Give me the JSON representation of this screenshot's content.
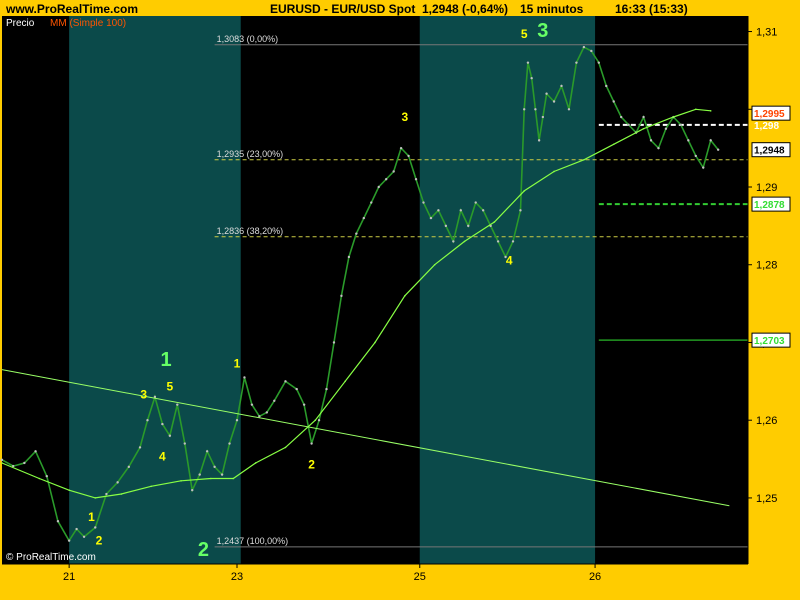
{
  "header": {
    "site": "www.ProRealTime.com",
    "instrument": "EURUSD - EUR/USD Spot",
    "last_quote": "1,2948 (-0,64%)",
    "interval": "15 minutos",
    "clock": "16:33 (15:33)"
  },
  "legend": {
    "price_label": "Precio",
    "ma_label": "MM (Simple 100)"
  },
  "copyright": "© ProRealTime.com",
  "colors": {
    "background": "#ffcc00",
    "plot_bg": "#000000",
    "band_bg": "#0b4a4a",
    "candles": "#2a9a2a",
    "ma_line": "#88ff44",
    "trendline": "#99ff66",
    "fib_line": "#cccc44",
    "wave_labels": "#ffff00",
    "wave_labels_major": "#66ff66"
  },
  "chart_data": {
    "type": "line",
    "title": "",
    "y_axis": {
      "range": [
        1.2415,
        1.312
      ],
      "ticks": [
        {
          "v": 1.31,
          "label": "1,31"
        },
        {
          "v": 1.3,
          "label": "1,30"
        },
        {
          "v": 1.29,
          "label": "1,29"
        },
        {
          "v": 1.28,
          "label": "1,28"
        },
        {
          "v": 1.27,
          "label": "1,27"
        },
        {
          "v": 1.26,
          "label": "1,26"
        },
        {
          "v": 1.25,
          "label": "1,25"
        }
      ]
    },
    "x_axis": {
      "range": [
        0,
        200
      ],
      "ticks": [
        {
          "t": 18,
          "label": "21"
        },
        {
          "t": 63,
          "label": "23"
        },
        {
          "t": 112,
          "label": "25"
        },
        {
          "t": 159,
          "label": "26"
        }
      ]
    },
    "shaded_periods": [
      [
        18,
        64
      ],
      [
        112,
        159
      ]
    ],
    "fibonacci_levels": [
      {
        "price": 1.3083,
        "label": "1,3083 (0,00%)",
        "from_t": 57
      },
      {
        "price": 1.2935,
        "label": "1,2935 (23,00%)",
        "from_t": 57
      },
      {
        "price": 1.2836,
        "label": "1,2836 (38,20%)",
        "from_t": 57
      },
      {
        "price": 1.2437,
        "label": "1,2437 (100,00%)",
        "from_t": 57
      }
    ],
    "price_markers": [
      {
        "price": 1.2995,
        "label": "1,2995",
        "color": "#ff4400",
        "boxed": true,
        "line": false
      },
      {
        "price": 1.298,
        "label": "1,298",
        "color": "#ffffff",
        "boxed": false,
        "line": true,
        "dash": true,
        "line_color": "#ffffff",
        "from_t": 160
      },
      {
        "price": 1.2948,
        "label": "1,2948",
        "color": "#000000",
        "boxed": true,
        "line": false
      },
      {
        "price": 1.2878,
        "label": "1,2878",
        "color": "#33dd33",
        "boxed": true,
        "line": true,
        "dash": true,
        "line_color": "#33cc33",
        "from_t": 160
      },
      {
        "price": 1.2703,
        "label": "1,2703",
        "color": "#33dd33",
        "boxed": true,
        "line": true,
        "dash": false,
        "line_color": "#229922",
        "from_t": 160
      }
    ],
    "series": [
      {
        "name": "Precio",
        "points": [
          [
            0,
            1.2549
          ],
          [
            3,
            1.2541
          ],
          [
            6,
            1.2545
          ],
          [
            9,
            1.256
          ],
          [
            12,
            1.2528
          ],
          [
            15,
            1.247
          ],
          [
            18,
            1.2445
          ],
          [
            20,
            1.246
          ],
          [
            22,
            1.245
          ],
          [
            25,
            1.2462
          ],
          [
            28,
            1.2505
          ],
          [
            31,
            1.252
          ],
          [
            34,
            1.254
          ],
          [
            37,
            1.2565
          ],
          [
            39,
            1.26
          ],
          [
            41,
            1.263
          ],
          [
            43,
            1.2595
          ],
          [
            45,
            1.258
          ],
          [
            47,
            1.262
          ],
          [
            49,
            1.257
          ],
          [
            51,
            1.251
          ],
          [
            53,
            1.253
          ],
          [
            55,
            1.256
          ],
          [
            57,
            1.254
          ],
          [
            59,
            1.253
          ],
          [
            61,
            1.257
          ],
          [
            63,
            1.26
          ],
          [
            65,
            1.2655
          ],
          [
            67,
            1.262
          ],
          [
            69,
            1.2605
          ],
          [
            71,
            1.261
          ],
          [
            73,
            1.2625
          ],
          [
            76,
            1.265
          ],
          [
            79,
            1.264
          ],
          [
            81,
            1.262
          ],
          [
            83,
            1.257
          ],
          [
            85,
            1.26
          ],
          [
            87,
            1.264
          ],
          [
            89,
            1.27
          ],
          [
            91,
            1.276
          ],
          [
            93,
            1.281
          ],
          [
            95,
            1.284
          ],
          [
            97,
            1.286
          ],
          [
            99,
            1.288
          ],
          [
            101,
            1.29
          ],
          [
            103,
            1.291
          ],
          [
            105,
            1.292
          ],
          [
            107,
            1.295
          ],
          [
            109,
            1.294
          ],
          [
            111,
            1.291
          ],
          [
            113,
            1.288
          ],
          [
            115,
            1.286
          ],
          [
            117,
            1.287
          ],
          [
            119,
            1.285
          ],
          [
            121,
            1.283
          ],
          [
            123,
            1.287
          ],
          [
            125,
            1.285
          ],
          [
            127,
            1.288
          ],
          [
            129,
            1.287
          ],
          [
            131,
            1.285
          ],
          [
            133,
            1.283
          ],
          [
            135,
            1.281
          ],
          [
            137,
            1.283
          ],
          [
            139,
            1.287
          ],
          [
            140,
            1.3
          ],
          [
            141,
            1.306
          ],
          [
            142,
            1.304
          ],
          [
            143,
            1.3
          ],
          [
            144,
            1.296
          ],
          [
            145,
            1.299
          ],
          [
            146,
            1.302
          ],
          [
            148,
            1.301
          ],
          [
            150,
            1.303
          ],
          [
            152,
            1.3
          ],
          [
            154,
            1.306
          ],
          [
            156,
            1.308
          ],
          [
            158,
            1.3075
          ],
          [
            160,
            1.306
          ],
          [
            162,
            1.303
          ],
          [
            164,
            1.301
          ],
          [
            166,
            1.299
          ],
          [
            168,
            1.298
          ],
          [
            170,
            1.297
          ],
          [
            172,
            1.299
          ],
          [
            174,
            1.296
          ],
          [
            176,
            1.295
          ],
          [
            178,
            1.2975
          ],
          [
            180,
            1.299
          ],
          [
            182,
            1.298
          ],
          [
            184,
            1.296
          ],
          [
            186,
            1.294
          ],
          [
            188,
            1.2925
          ],
          [
            190,
            1.296
          ],
          [
            192,
            1.2948
          ]
        ]
      },
      {
        "name": "MM (Simple 100)",
        "points": [
          [
            0,
            1.2545
          ],
          [
            10,
            1.2525
          ],
          [
            18,
            1.251
          ],
          [
            25,
            1.25
          ],
          [
            32,
            1.2505
          ],
          [
            40,
            1.2515
          ],
          [
            48,
            1.2522
          ],
          [
            56,
            1.2525
          ],
          [
            62,
            1.2525
          ],
          [
            68,
            1.2545
          ],
          [
            76,
            1.2565
          ],
          [
            84,
            1.26
          ],
          [
            92,
            1.265
          ],
          [
            100,
            1.27
          ],
          [
            108,
            1.276
          ],
          [
            116,
            1.28
          ],
          [
            124,
            1.283
          ],
          [
            132,
            1.2855
          ],
          [
            140,
            1.2895
          ],
          [
            148,
            1.292
          ],
          [
            156,
            1.2935
          ],
          [
            164,
            1.2955
          ],
          [
            172,
            1.2975
          ],
          [
            180,
            1.299
          ],
          [
            186,
            1.3
          ],
          [
            190,
            1.2998
          ]
        ]
      }
    ],
    "trendline": {
      "from": [
        0,
        1.2665
      ],
      "to": [
        195,
        1.249
      ]
    },
    "wave_labels": [
      {
        "text": "1",
        "t": 24,
        "price": 1.247,
        "major": false
      },
      {
        "text": "2",
        "t": 26,
        "price": 1.244,
        "major": false
      },
      {
        "text": "3",
        "t": 38,
        "price": 1.2628,
        "major": false
      },
      {
        "text": "4",
        "t": 43,
        "price": 1.2548,
        "major": false
      },
      {
        "text": "5",
        "t": 45,
        "price": 1.2638,
        "major": false
      },
      {
        "text": "1",
        "t": 44,
        "price": 1.267,
        "major": true
      },
      {
        "text": "2",
        "t": 54,
        "price": 1.2425,
        "major": true
      },
      {
        "text": "1",
        "t": 63,
        "price": 1.2668,
        "major": false
      },
      {
        "text": "2",
        "t": 83,
        "price": 1.2538,
        "major": false
      },
      {
        "text": "3",
        "t": 108,
        "price": 1.2985,
        "major": false
      },
      {
        "text": "4",
        "t": 136,
        "price": 1.28,
        "major": false
      },
      {
        "text": "5",
        "t": 140,
        "price": 1.3092,
        "major": false
      },
      {
        "text": "3",
        "t": 145,
        "price": 1.3093,
        "major": true
      }
    ]
  }
}
